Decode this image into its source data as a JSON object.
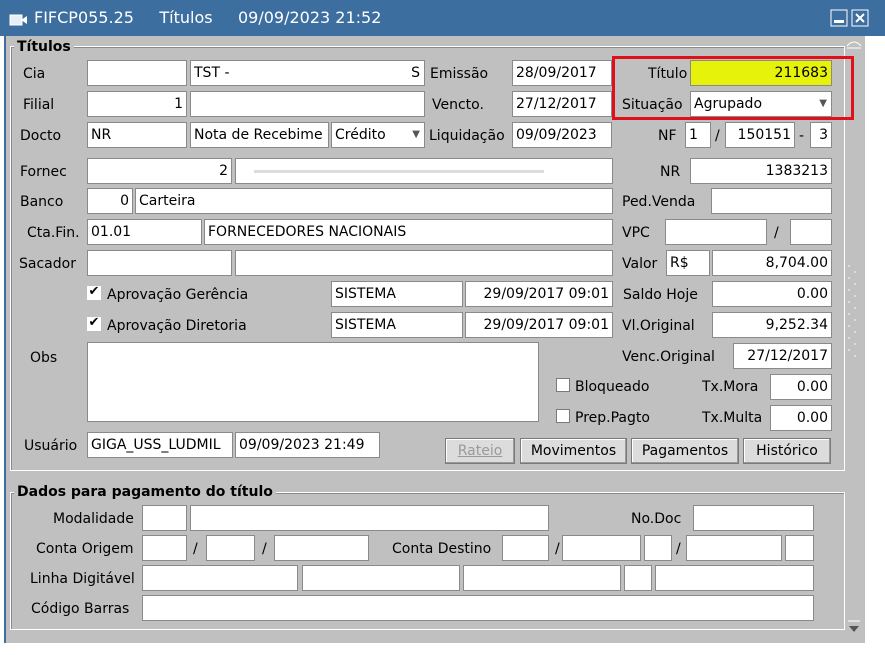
{
  "window": {
    "title": "FIFCP055.25     Títulos     09/09/2023 21:52",
    "minimize_icon": "minimize-icon",
    "close_icon": "close-icon",
    "app_icon": "form-icon"
  },
  "titulos": {
    "section_label": "Títulos",
    "cia_label": "Cia",
    "cia_code": "",
    "cia_name": "TST -",
    "cia_name_suffix": "S",
    "emissao_label": "Emissão",
    "emissao": "28/09/2017",
    "titulo_label": "Título",
    "titulo": "211683",
    "filial_label": "Filial",
    "filial_code": "1",
    "filial_name": "",
    "vencto_label": "Vencto.",
    "vencto": "27/12/2017",
    "situacao_label": "Situação",
    "situacao": "Agrupado",
    "docto_label": "Docto",
    "docto_code": "NR",
    "docto_desc": "Nota de Recebime",
    "docto_type": "Crédito",
    "liquidacao_label": "Liquidação",
    "liquidacao": "09/09/2023",
    "nf_label": "NF",
    "nf_1": "1",
    "nf_sep": "/",
    "nf_2": "150151",
    "nf_dash": "-",
    "nf_3": "3",
    "fornec_label": "Fornec",
    "fornec_code": "2",
    "fornec_name": "",
    "nr_label": "NR",
    "nr": "1383213",
    "banco_label": "Banco",
    "banco_code": "0",
    "banco_name": "Carteira",
    "ped_venda_label": "Ped.Venda",
    "ped_venda": "",
    "cta_fin_label": "Cta.Fin.",
    "cta_fin_code": "01.01",
    "cta_fin_name": "FORNECEDORES NACIONAIS",
    "vpc_label": "VPC",
    "vpc_1": "",
    "vpc_sep": "/",
    "vpc_2": "",
    "sacador_label": "Sacador",
    "sacador_code": "",
    "sacador_name": "",
    "valor_label": "Valor",
    "valor_currency": "R$",
    "valor": "8,704.00",
    "aprov_gerencia_label": "Aprovação Gerência",
    "aprov_gerencia_user": "SISTEMA",
    "aprov_gerencia_date": "29/09/2017 09:01",
    "saldo_hoje_label": "Saldo Hoje",
    "saldo_hoje": "0.00",
    "aprov_diretoria_label": "Aprovação Diretoria",
    "aprov_diretoria_user": "SISTEMA",
    "aprov_diretoria_date": "29/09/2017 09:01",
    "vl_original_label": "Vl.Original",
    "vl_original": "9,252.34",
    "obs_label": "Obs",
    "obs": "",
    "venc_original_label": "Venc.Original",
    "venc_original": "27/12/2017",
    "bloqueado_label": "Bloqueado",
    "tx_mora_label": "Tx.Mora",
    "tx_mora": "0.00",
    "prep_pagto_label": "Prep.Pagto",
    "tx_multa_label": "Tx.Multa",
    "tx_multa": "0.00",
    "usuario_label": "Usuário",
    "usuario": "GIGA_USS_LUDMIL",
    "usuario_date": "09/09/2023 21:49"
  },
  "buttons": {
    "rateio": "Rateio",
    "movimentos": "Movimentos",
    "pagamentos": "Pagamentos",
    "historico": "Histórico"
  },
  "pagamento": {
    "section_label": "Dados para pagamento do título",
    "modalidade_label": "Modalidade",
    "no_doc_label": "No.Doc",
    "conta_origem_label": "Conta Origem",
    "conta_destino_label": "Conta Destino",
    "sep": "/",
    "linha_digitavel_label": "Linha Digitável",
    "codigo_barras_label": "Código Barras"
  },
  "colors": {
    "titlebar": "#3d6ea0",
    "highlight_field": "#e6f20a",
    "annotation_box": "#e0101a"
  }
}
